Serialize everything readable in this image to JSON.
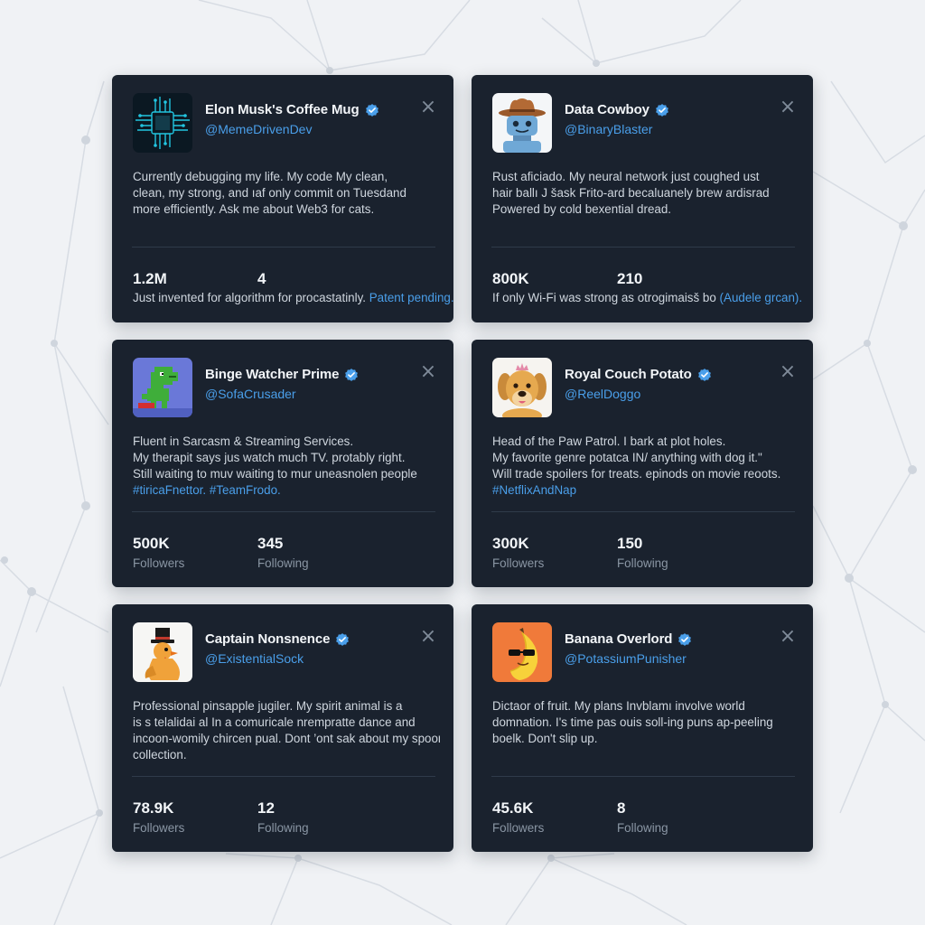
{
  "colors": {
    "card_bg": "#1a222e",
    "accent": "#4a9fea",
    "page_bg": "#f0f2f5"
  },
  "cards": [
    {
      "name": "Elon Musk's Coffee Mug",
      "handle": "@MemeDrivenDev",
      "avatar_icon": "circuit-chip-icon",
      "bio": [
        "Currently debugging my life. My code My clean,",
        "clean, my strong, and ıaf only commit on Tuesdand",
        "more efficiently. Ask me about Web3 for cats."
      ],
      "stat1_value": "1.2M",
      "stat2_value": "4",
      "note_text": "Just invented for algorithm for procastatinly.",
      "note_link": "Patent pending."
    },
    {
      "name": "Data Cowboy",
      "handle": "@BinaryBlaster",
      "avatar_icon": "cowboy-robot-icon",
      "bio": [
        "Rust aficiado. My neural network just coughed ust",
        "hair ballı J šask Frito-ard becaluanely brew ardisrad",
        "Powered by cold bexential dread."
      ],
      "stat1_value": "800K",
      "stat2_value": "210",
      "note_text": "If only Wi-Fi was strong as otrogimaisš bo",
      "note_link": "(Audele grcan)."
    },
    {
      "name": "Binge Watcher Prime",
      "handle": "@SofaCrusader",
      "avatar_icon": "pixel-dinosaur-icon",
      "bio": [
        "Fluent in Sarcasm & Streaming Services.",
        "My therapit says jus watch much TV. protably right.",
        "Still waiting to muv waiting to mur uneasnolen people"
      ],
      "bio_tags": "#tiricaFnettor. #TeamFrodo.",
      "stat1_value": "500K",
      "stat1_label": "Followers",
      "stat2_value": "345",
      "stat2_label": "Following"
    },
    {
      "name": "Royal Couch Potato",
      "handle": "@ReelDoggo",
      "avatar_icon": "crowned-dog-icon",
      "bio": [
        "Head of the Paw Patrol. I bark at plot holes.",
        "My favorite genre potatca IN/ anything with dog it.\"",
        "Will trade spoilers for treats. epinods on movie reoots."
      ],
      "bio_tags": "#NetflixAndNap",
      "stat1_value": "300K",
      "stat1_label": "Followers",
      "stat2_value": "150",
      "stat2_label": "Following"
    },
    {
      "name": "Captain Nonsnence",
      "handle": "@ExistentialSock",
      "avatar_icon": "top-hat-chicken-icon",
      "bio": [
        "Professional pinsapple jugiler. My spirit animal is a",
        "is s telalidai al In a comuricale nrempratte dance and",
        "incoon-womily chircen pual. Dont ’ont sak about my spoon",
        "collection."
      ],
      "stat1_value": "78.9K",
      "stat1_label": "Followers",
      "stat2_value": "12",
      "stat2_label": "Following"
    },
    {
      "name": "Banana Overlord",
      "handle": "@PotassiumPunisher",
      "avatar_icon": "sunglasses-banana-icon",
      "bio": [
        "Dictaor of fruit. My plans Invblamı involve world",
        "domnation. I's time pas ouis soll-ing puns ap-peeling",
        "boelk. Don't slip up."
      ],
      "stat1_value": "45.6K",
      "stat1_label": "Followers",
      "stat2_value": "8",
      "stat2_label": "Following"
    }
  ]
}
